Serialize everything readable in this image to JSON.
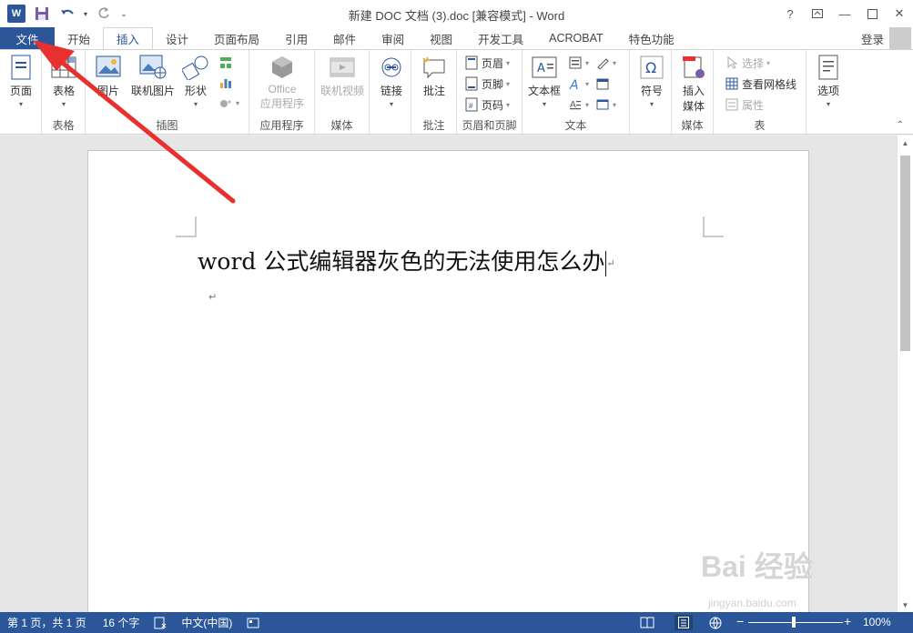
{
  "window": {
    "title": "新建 DOC 文档 (3).doc [兼容模式] - Word",
    "help": "?",
    "login": "登录"
  },
  "tabs": [
    "文件",
    "开始",
    "插入",
    "设计",
    "页面布局",
    "引用",
    "邮件",
    "审阅",
    "视图",
    "开发工具",
    "ACROBAT",
    "特色功能"
  ],
  "active_tab": "插入",
  "ribbon": {
    "pages": {
      "label": "页面",
      "group": ""
    },
    "tables": {
      "label": "表格",
      "group": "表格"
    },
    "illustrations": {
      "picture": "图片",
      "online_picture": "联机图片",
      "shapes": "形状",
      "group": "插图"
    },
    "apps": {
      "label_1": "Office",
      "label_2": "应用程序",
      "group": "应用程序"
    },
    "media": {
      "label": "联机视频",
      "group": "媒体"
    },
    "links": {
      "label": "链接",
      "group": ""
    },
    "comments": {
      "label": "批注",
      "group": "批注"
    },
    "header_footer": {
      "header": "页眉",
      "footer": "页脚",
      "page_number": "页码",
      "group": "页眉和页脚"
    },
    "text": {
      "textbox": "文本框",
      "group": "文本"
    },
    "symbols": {
      "label": "符号"
    },
    "media2": {
      "label_1": "插入",
      "label_2": "媒体",
      "group": "媒体"
    },
    "table_tools": {
      "select": "选择",
      "gridlines": "查看网格线",
      "properties": "属性",
      "group": "表"
    },
    "options": {
      "label": "选项"
    }
  },
  "document": {
    "text": "word 公式编辑器灰色的无法使用怎么办",
    "para_mark": "↵"
  },
  "status": {
    "page": "第 1 页，共 1 页",
    "words": "16 个字",
    "language": "中文(中国)",
    "zoom": "100%",
    "zoom_minus": "−",
    "zoom_plus": "+"
  },
  "watermark": {
    "brand": "Bai 经验",
    "url": "jingyan.baidu.com"
  },
  "colors": {
    "accent": "#2b579a",
    "arrow": "#e8312e"
  }
}
